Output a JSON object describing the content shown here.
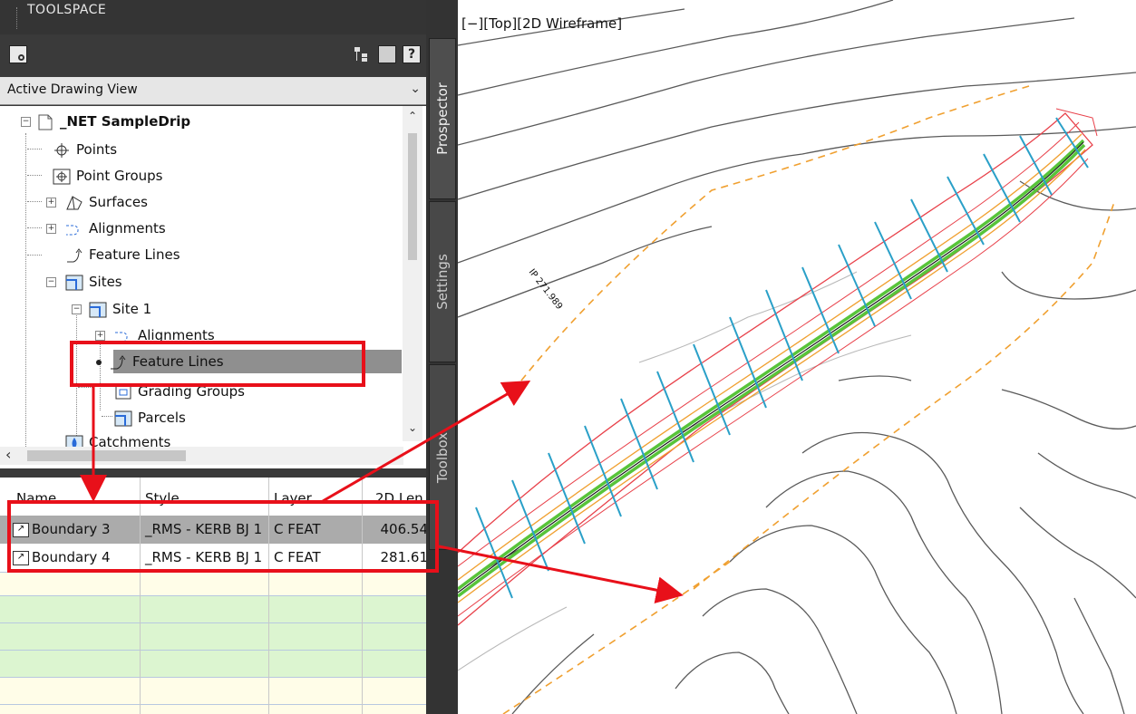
{
  "toolspace": {
    "title": "TOOLSPACE",
    "view_select": "Active Drawing View",
    "tree": {
      "root": "_NET SampleDrip",
      "items": [
        "Points",
        "Point Groups",
        "Surfaces",
        "Alignments",
        "Feature Lines",
        "Sites"
      ],
      "site": "Site 1",
      "site_items": [
        "Alignments",
        "Feature Lines",
        "Grading Groups",
        "Parcels"
      ],
      "last": "Catchments"
    },
    "tabs": [
      "Prospector",
      "Settings",
      "Toolbox"
    ],
    "grid": {
      "columns": [
        "Name",
        "Style",
        "Layer",
        "2D Len"
      ],
      "rows": [
        {
          "name": "Boundary 3",
          "style": "_RMS - KERB BJ 1",
          "layer": "C FEAT",
          "len": "406.54"
        },
        {
          "name": "Boundary 4",
          "style": "_RMS - KERB BJ 1",
          "layer": "C FEAT",
          "len": "281.61"
        }
      ]
    }
  },
  "viewport": {
    "label": "[−][Top][2D Wireframe]",
    "annotation": "IP 271.989"
  },
  "colors": {
    "highlight_box": "#e8101a",
    "arrow": "#e8101a",
    "boundary": "#e8414a",
    "centerline": "#58c43a",
    "offset": "#f0a030",
    "sections": "#2aa0c8",
    "contours": "#555555"
  }
}
